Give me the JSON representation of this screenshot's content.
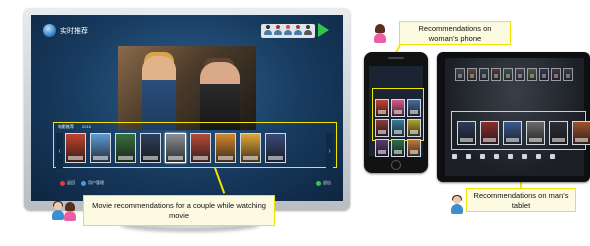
{
  "tv": {
    "app_title": "实时推荐",
    "tabs": [
      "电影推荐",
      "2015"
    ],
    "legend": [
      {
        "color": "#e23a3a",
        "label": "返回"
      },
      {
        "color": "#3a9de2",
        "label": "用户管理"
      },
      {
        "color": "#3ac24a",
        "label": "退出"
      }
    ],
    "posters": [
      {
        "color": "#c2442e"
      },
      {
        "color": "#5f9ad2"
      },
      {
        "color": "#3a6e3e"
      },
      {
        "color": "#2f3f5a"
      },
      {
        "color": "#8a8f96"
      },
      {
        "color": "#b84a3a"
      },
      {
        "color": "#d3882e"
      },
      {
        "color": "#e0a63a"
      },
      {
        "color": "#3a4a7a"
      }
    ]
  },
  "callouts": {
    "tv": "Movie recommendations for a couple while watching movie",
    "phone": "Recommendations on woman’s phone",
    "tablet": "Recommendations on man’s tablet"
  },
  "colors": {
    "highlight": "#f2e600",
    "callout_bg": "#fcfbe2",
    "tv_screen": "#1c4670"
  },
  "phone": {
    "posters": [
      {
        "color": "#c2442e"
      },
      {
        "color": "#d65a8a"
      },
      {
        "color": "#4a6a9a"
      },
      {
        "color": "#8a3a3a"
      },
      {
        "color": "#3a7a9a"
      },
      {
        "color": "#b0a02e"
      },
      {
        "color": "#5a3a6a"
      },
      {
        "color": "#2e6e4a"
      },
      {
        "color": "#c27a3a"
      }
    ]
  },
  "tablet": {
    "posters": [
      {
        "color": "#2e3a5a"
      },
      {
        "color": "#8a2e2e"
      },
      {
        "color": "#3a5a8a"
      },
      {
        "color": "#6a6a6a"
      },
      {
        "color": "#2e2e3a"
      },
      {
        "color": "#a0522e"
      }
    ],
    "top_posters": [
      {
        "color": "#5a5a5a"
      },
      {
        "color": "#7a5a3a"
      },
      {
        "color": "#3a4a5a"
      },
      {
        "color": "#6a3a3a"
      },
      {
        "color": "#4a5a4a"
      },
      {
        "color": "#5a4a6a"
      },
      {
        "color": "#6a6a4a"
      },
      {
        "color": "#3a3a5a"
      },
      {
        "color": "#5a3a4a"
      },
      {
        "color": "#4a4a4a"
      }
    ]
  }
}
